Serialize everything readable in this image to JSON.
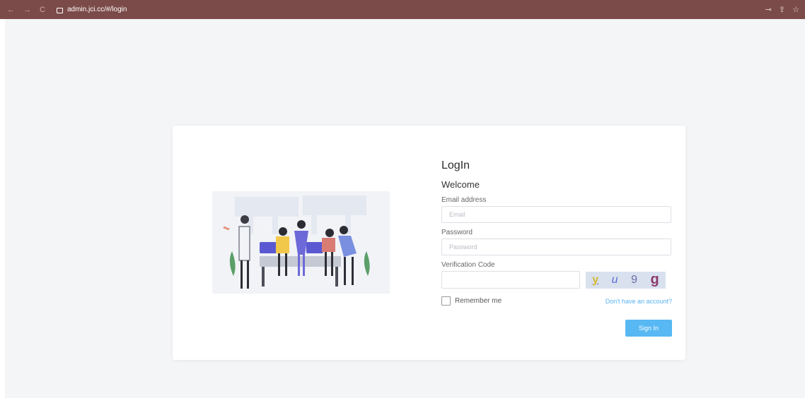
{
  "browser": {
    "url": "admin.jci.cc/#/login",
    "nav_icons": [
      "←",
      "→",
      "C"
    ],
    "right_icons": [
      "⊸",
      "⇪",
      "☆"
    ]
  },
  "login": {
    "title": "LogIn",
    "subtitle": "Welcome",
    "email_label": "Email address",
    "email_placeholder": "Email",
    "password_label": "Password",
    "password_placeholder": "Password",
    "verification_label": "Verification Code",
    "captcha": [
      "y",
      "u",
      "9",
      "g"
    ],
    "remember_label": "Remember me",
    "signup_link": "Don't have an account?",
    "signin_button": "Sign In"
  }
}
